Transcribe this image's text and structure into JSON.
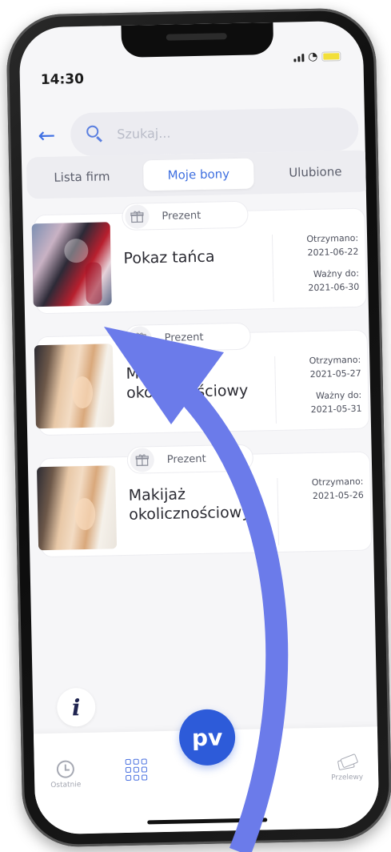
{
  "status_bar": {
    "time": "14:30"
  },
  "search": {
    "placeholder": "Szukaj..."
  },
  "tabs": [
    {
      "label": "Lista firm"
    },
    {
      "label": "Moje bony"
    },
    {
      "label": "Ulubione"
    }
  ],
  "vouchers": [
    {
      "badge": "Prezent",
      "title": "Pokaz tańca",
      "received_label": "Otrzymano:",
      "received_date": "2021-06-22",
      "valid_label": "Ważny do:",
      "valid_date": "2021-06-30"
    },
    {
      "badge": "Prezent",
      "title": "Makijaż okolicznościowy",
      "received_label": "Otrzymano:",
      "received_date": "2021-05-27",
      "valid_label": "Ważny do:",
      "valid_date": "2021-05-31"
    },
    {
      "badge": "Prezent",
      "title": "Makijaż okolicznościowy",
      "received_label": "Otrzymano:",
      "received_date": "2021-05-26"
    }
  ],
  "info": {
    "glyph": "i"
  },
  "bottom_nav": {
    "recent_label": "Ostatnie",
    "center_logo": "pv",
    "transfers_label": "Przelewy"
  },
  "colors": {
    "accent": "#3e6fe0",
    "fab": "#2d5bd9",
    "arrow": "#6b7bea"
  },
  "icons": [
    "back-arrow-icon",
    "search-icon",
    "gift-icon",
    "info-icon",
    "clock-icon",
    "grid-icon",
    "money-icon"
  ]
}
